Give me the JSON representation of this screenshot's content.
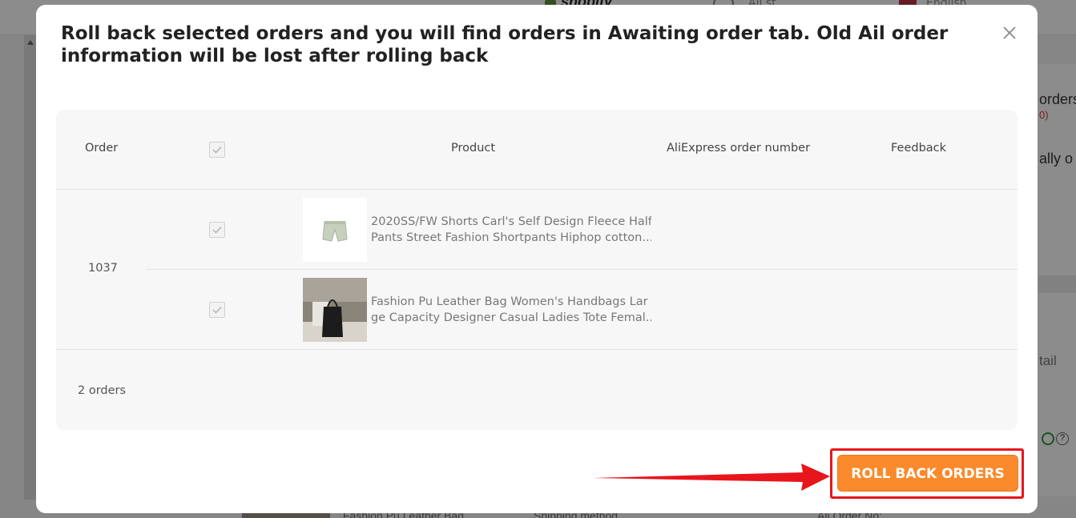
{
  "background": {
    "brand_text": "shopify",
    "nav_item": "All st",
    "language": "English",
    "right_panel": {
      "orders_text": "orders",
      "count_text": "0)",
      "auto_text": "ally o",
      "detail_text": "tail"
    },
    "bottom_row": {
      "product_text": "Fashion Pu Leather Bag",
      "shipping_text": "Shipping method",
      "ali_order_text": "Ali Order No:"
    }
  },
  "modal": {
    "title": "Roll back selected orders and you will find orders in Awaiting order tab. Old Ail order information will be lost after rolling back",
    "table": {
      "columns": {
        "order": "Order",
        "product": "Product",
        "ali_order_number": "AliExpress order number",
        "feedback": "Feedback"
      },
      "order_id": "1037",
      "rows": [
        {
          "title_line1": "2020SS/FW Shorts Carl's Self Design Fleece Half",
          "title_line2": "Pants Street Fashion Shortpants Hiphop cotton...",
          "checked": true,
          "image": "shorts-product-image"
        },
        {
          "title_line1": "Fashion Pu Leather Bag Women's Handbags Lar",
          "title_line2": "ge Capacity Designer Casual Ladies Tote Femal...",
          "checked": true,
          "image": "bag-product-image"
        }
      ],
      "footer_count": "2 orders"
    },
    "primary_button": "ROLL BACK ORDERS"
  },
  "colors": {
    "accent": "#fa8a2c",
    "highlight": "#e8151b"
  }
}
